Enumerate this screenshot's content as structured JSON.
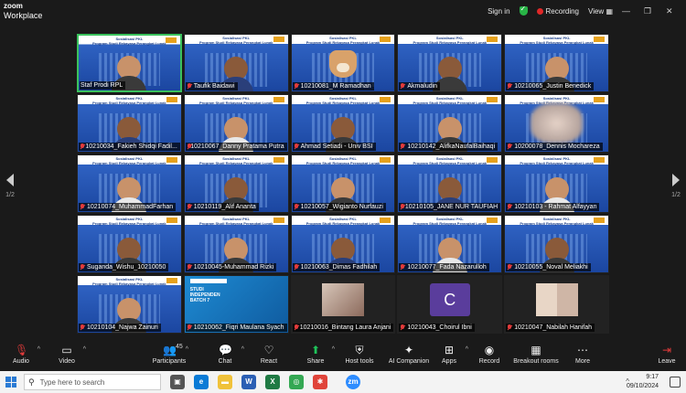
{
  "app": {
    "logo_line1": "zoom",
    "logo_line2": "Workplace"
  },
  "titlebar": {
    "signin": "Sign in",
    "recording": "Recording",
    "view": "View",
    "min": "—",
    "restore": "❐",
    "close": "✕"
  },
  "pager": {
    "left": "1/2",
    "right": "1/2"
  },
  "banner": {
    "title": "Sosialisasi PKL",
    "subtitle": "Program Studi Rekayasa Perangkat Lunak",
    "badge": "37"
  },
  "studi": {
    "line1": "STUDI",
    "line2": "INDEPENDEN",
    "line3": "BATCH 7"
  },
  "participants": [
    {
      "name": "Staf Prodi RPL",
      "kind": "banner",
      "active": true,
      "muted": false
    },
    {
      "name": "Taufik Baidawi",
      "kind": "banner",
      "active": false,
      "muted": true
    },
    {
      "name": "10210081_M Ramadhan",
      "kind": "cat",
      "active": false,
      "muted": true
    },
    {
      "name": "Akmaludin",
      "kind": "banner",
      "active": false,
      "muted": true
    },
    {
      "name": "10210065_Justin Benedick",
      "kind": "banner",
      "active": false,
      "muted": true
    },
    {
      "name": "10210034_Fakieh Shidqi Fadil...",
      "kind": "banner",
      "active": false,
      "muted": true
    },
    {
      "name": "10210067_Danny Pratama Putra",
      "kind": "banner",
      "active": false,
      "muted": true
    },
    {
      "name": "Ahmad Setiadi - Univ BSI",
      "kind": "banner",
      "active": false,
      "muted": true
    },
    {
      "name": "10210142_AlifkaNaufalBaihaqi",
      "kind": "banner",
      "active": false,
      "muted": true
    },
    {
      "name": "10200078_Dennis Mochareza",
      "kind": "blur",
      "active": false,
      "muted": true
    },
    {
      "name": "10210074_MuhammadFarhan",
      "kind": "banner",
      "active": false,
      "muted": true
    },
    {
      "name": "10210119_Alif Ananta",
      "kind": "banner",
      "active": false,
      "muted": true
    },
    {
      "name": "10210057_Wigianto Nurfauzi",
      "kind": "banner",
      "active": false,
      "muted": true
    },
    {
      "name": "10210105_JANE NUR TAUFIAH",
      "kind": "banner",
      "active": false,
      "muted": true
    },
    {
      "name": "10210103 - Rahmat Alfayyan",
      "kind": "banner",
      "active": false,
      "muted": true
    },
    {
      "name": "Suganda_Wishu_10210050",
      "kind": "banner",
      "active": false,
      "muted": true
    },
    {
      "name": "10210045-Muhammad Rizki",
      "kind": "banner",
      "active": false,
      "muted": true
    },
    {
      "name": "10210063_Dimas Fadhilah",
      "kind": "banner",
      "active": false,
      "muted": true
    },
    {
      "name": "10210077_Fada Nazarulloh",
      "kind": "banner",
      "active": false,
      "muted": true
    },
    {
      "name": "10210055_Noval Meliakhi",
      "kind": "banner",
      "active": false,
      "muted": true
    },
    {
      "name": "10210104_Najwa Zainuri",
      "kind": "banner",
      "active": false,
      "muted": true
    },
    {
      "name": "10210062_Fiqri Maulana Syach",
      "kind": "studi",
      "active": false,
      "muted": true
    },
    {
      "name": "10210016_Bintang Laura Anjani",
      "kind": "photo",
      "active": false,
      "muted": true
    },
    {
      "name": "10210043_Choirul Ibni",
      "kind": "avatar",
      "avatar_letter": "C",
      "active": false,
      "muted": true
    },
    {
      "name": "10210047_Nabilah Hanifah",
      "kind": "photo2",
      "active": false,
      "muted": true
    }
  ],
  "toolbar": {
    "audio": "Audio",
    "video": "Video",
    "participants": "Participants",
    "participants_count": "45",
    "chat": "Chat",
    "react": "React",
    "share": "Share",
    "host_tools": "Host tools",
    "ai_companion": "AI Companion",
    "apps": "Apps",
    "record": "Record",
    "breakout_rooms": "Breakout rooms",
    "more": "More",
    "leave": "Leave"
  },
  "taskbar": {
    "search_placeholder": "Type here to search",
    "time": "9:17",
    "date": "09/10/2024"
  }
}
